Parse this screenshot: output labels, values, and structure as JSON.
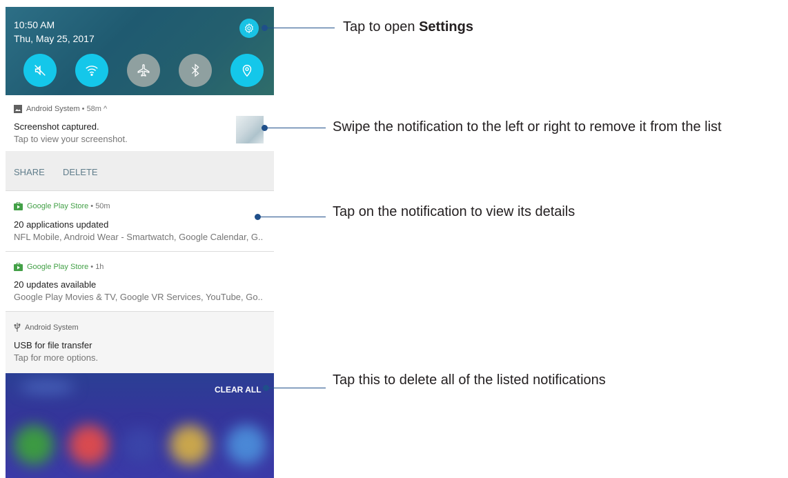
{
  "quick_settings": {
    "time": "10:50 AM",
    "date": "Thu, May 25, 2017",
    "tiles": [
      {
        "icon": "sound-off-icon",
        "state": "on"
      },
      {
        "icon": "wifi-icon",
        "state": "on"
      },
      {
        "icon": "airplane-icon",
        "state": "off"
      },
      {
        "icon": "bluetooth-icon",
        "state": "off"
      },
      {
        "icon": "location-icon",
        "state": "on"
      }
    ],
    "settings_icon": "gear-icon"
  },
  "notifications": [
    {
      "app": "Android System",
      "meta": "• 58m ^",
      "title": "Screenshot captured.",
      "body": "Tap to view your screenshot.",
      "actions": [
        "SHARE",
        "DELETE"
      ],
      "app_color": "#616161"
    },
    {
      "app": "Google Play Store",
      "meta": "• 50m",
      "title": "20 applications updated",
      "body": "NFL Mobile, Android Wear - Smartwatch, Google Calendar, G..",
      "app_color": "#4caf50"
    },
    {
      "app": "Google Play Store",
      "meta": "• 1h",
      "title": "20 updates available",
      "body": "Google Play Movies & TV, Google VR Services, YouTube, Go..",
      "app_color": "#4caf50"
    },
    {
      "app": "Android System",
      "title": "USB for file transfer",
      "body": "Tap for more options.",
      "app_color": "#616161"
    }
  ],
  "clear_all": "CLEAR ALL",
  "callouts": {
    "settings_prefix": "Tap to open ",
    "settings_bold": "Settings",
    "swipe": "Swipe the notification to the left or right to remove it from the list",
    "tap": "Tap on the notification to view its details",
    "clear": "Tap this to delete all of the listed notifications"
  },
  "colors": {
    "accent": "#14c7ea",
    "callout_line": "#1f4f8a"
  }
}
